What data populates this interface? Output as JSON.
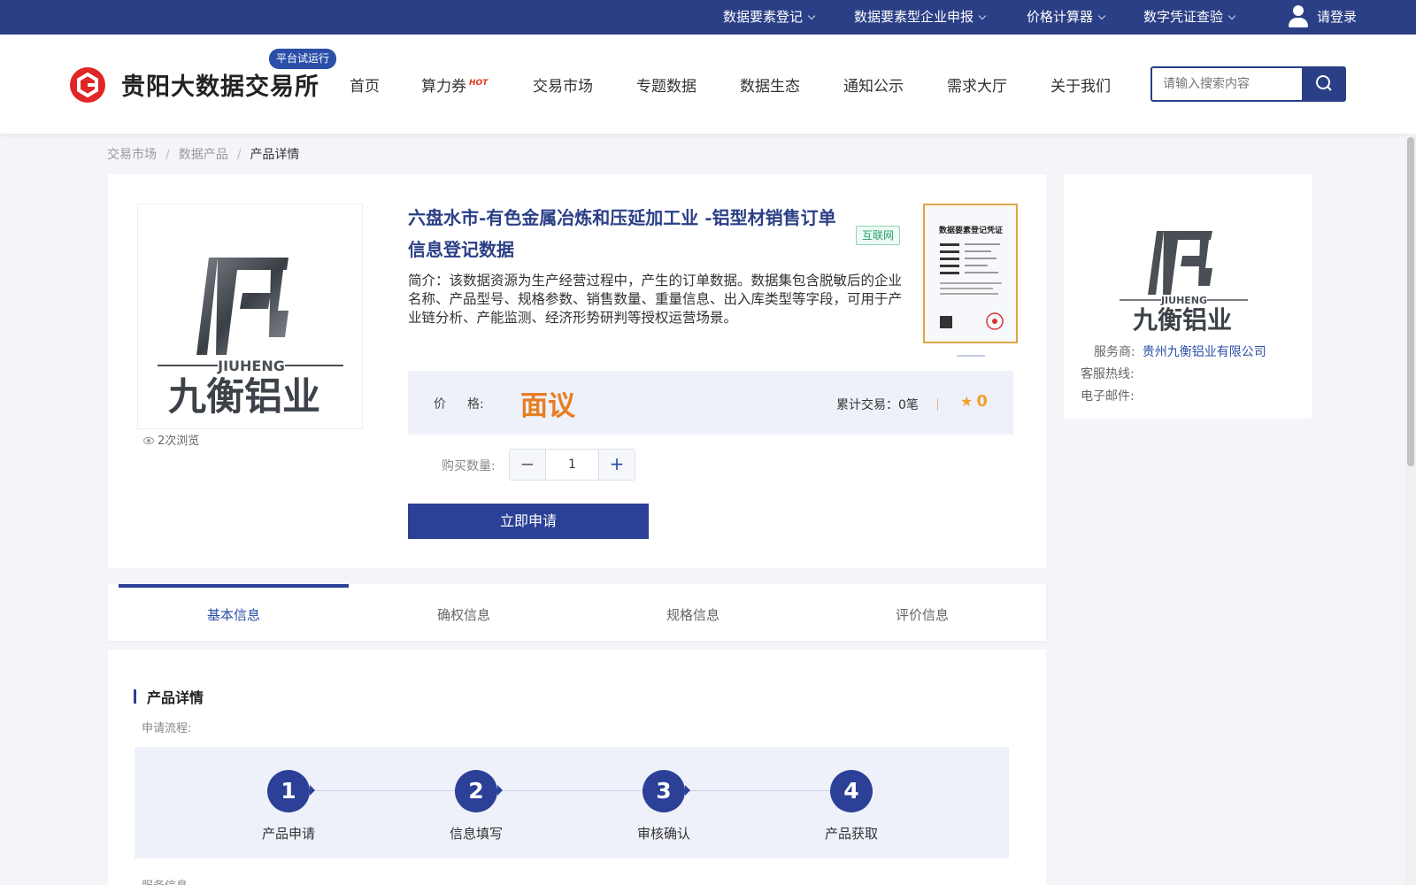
{
  "topbar": {
    "items": [
      {
        "label": "数据要素登记"
      },
      {
        "label": "数据要素型企业申报"
      },
      {
        "label": "价格计算器"
      },
      {
        "label": "数字凭证查验"
      }
    ],
    "login": "请登录"
  },
  "header": {
    "logo_text": "贵阳大数据交易所",
    "trial_badge": "平台试运行",
    "nav": [
      {
        "label": "首页"
      },
      {
        "label": "算力券",
        "tag": "HOT"
      },
      {
        "label": "交易市场"
      },
      {
        "label": "专题数据"
      },
      {
        "label": "数据生态"
      },
      {
        "label": "通知公示"
      },
      {
        "label": "需求大厅"
      },
      {
        "label": "关于我们"
      }
    ],
    "search_placeholder": "请输入搜索内容"
  },
  "breadcrumb": [
    "交易市场",
    "数据产品",
    "产品详情"
  ],
  "product": {
    "image_brand_cn": "九衡铝业",
    "image_brand_en": "JIUHENG",
    "views": "2次浏览",
    "title": "六盘水市-有色金属冶炼和压延加工业 -铝型材销售订单信息登记数据",
    "source_tag": "互联网",
    "description": "简介：该数据资源为生产经营过程中，产生的订单数据。数据集包含脱敏后的企业名称、产品型号、规格参数、销售数量、重量信息、出入库类型等字段，可用于产业链分析、产能监测、经济形势研判等授权运营场景。",
    "certificate_title": "数据要素登记凭证",
    "price_label_1": "价",
    "price_label_2": "格:",
    "price_value": "面议",
    "trade_label": "累计交易：",
    "trade_value": "0笔",
    "rating": "0",
    "qty_label": "购买数量:",
    "qty_value": "1",
    "apply_button": "立即申请"
  },
  "provider": {
    "brand_cn": "九衡铝业",
    "brand_en": "JIUHENG",
    "provider_label": "服务商:",
    "provider_value": "贵州九衡铝业有限公司",
    "hotline_label": "客服热线:",
    "email_label": "电子邮件:"
  },
  "tabs": [
    {
      "label": "基本信息",
      "active": true
    },
    {
      "label": "确权信息",
      "active": false
    },
    {
      "label": "规格信息",
      "active": false
    },
    {
      "label": "评价信息",
      "active": false
    }
  ],
  "detail": {
    "section_title": "产品详情",
    "flow_label": "申请流程:",
    "steps": [
      {
        "num": "1",
        "label": "产品申请"
      },
      {
        "num": "2",
        "label": "信息填写"
      },
      {
        "num": "3",
        "label": "审核确认"
      },
      {
        "num": "4",
        "label": "产品获取"
      }
    ],
    "service_label": "服务信息"
  },
  "colors": {
    "primary": "#2b3f86",
    "accent_orange": "#e67e22",
    "panel_bg": "#eff1fa"
  }
}
